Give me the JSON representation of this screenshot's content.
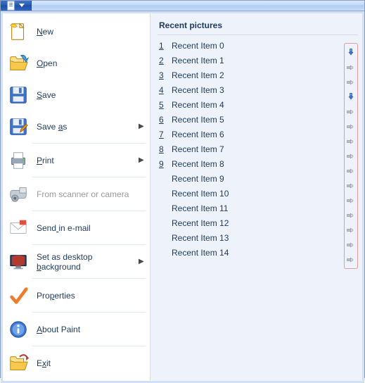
{
  "titlebar": {
    "app_button": "app-menu"
  },
  "menu": [
    {
      "id": "new",
      "label": "New",
      "accel_index": 0,
      "icon": "new-doc",
      "disabled": false,
      "submenu": false
    },
    {
      "id": "open",
      "label": "Open",
      "accel_index": 0,
      "icon": "open",
      "disabled": false,
      "submenu": false
    },
    {
      "id": "save",
      "label": "Save",
      "accel_index": 0,
      "icon": "save",
      "disabled": false,
      "submenu": false
    },
    {
      "id": "saveas",
      "label": "Save as",
      "accel_index": 5,
      "icon": "saveas",
      "disabled": false,
      "submenu": true
    },
    {
      "id": "print",
      "label": "Print",
      "accel_index": 0,
      "icon": "print",
      "disabled": false,
      "submenu": true
    },
    {
      "id": "scanner",
      "label": "From scanner or camera",
      "accel_index": -1,
      "icon": "scanner",
      "disabled": true,
      "submenu": false
    },
    {
      "id": "email",
      "label": "Send in e-mail",
      "accel_index": 4,
      "icon": "email",
      "disabled": false,
      "submenu": false
    },
    {
      "id": "desktop",
      "label": "Set as desktop background",
      "accel_index": 15,
      "icon": "desktop",
      "disabled": false,
      "submenu": true
    },
    {
      "id": "properties",
      "label": "Properties",
      "accel_index": 3,
      "icon": "check",
      "disabled": false,
      "submenu": false
    },
    {
      "id": "about",
      "label": "About Paint",
      "accel_index": 0,
      "icon": "info",
      "disabled": false,
      "submenu": false
    },
    {
      "id": "exit",
      "label": "Exit",
      "accel_index": 1,
      "icon": "exit",
      "disabled": false,
      "submenu": false
    }
  ],
  "menu_separators_after": [
    "saveas",
    "print",
    "scanner",
    "email",
    "desktop",
    "properties",
    "about"
  ],
  "recent": {
    "title": "Recent pictures",
    "items": [
      {
        "num": "1",
        "label": "Recent Item 0",
        "pinned": true
      },
      {
        "num": "2",
        "label": "Recent Item 1",
        "pinned": false
      },
      {
        "num": "3",
        "label": "Recent Item 2",
        "pinned": false
      },
      {
        "num": "4",
        "label": "Recent Item 3",
        "pinned": true
      },
      {
        "num": "5",
        "label": "Recent Item 4",
        "pinned": false
      },
      {
        "num": "6",
        "label": "Recent Item 5",
        "pinned": false
      },
      {
        "num": "7",
        "label": "Recent Item 6",
        "pinned": false
      },
      {
        "num": "8",
        "label": "Recent Item 7",
        "pinned": false
      },
      {
        "num": "9",
        "label": "Recent Item 8",
        "pinned": false
      },
      {
        "num": "",
        "label": "Recent Item 9",
        "pinned": false
      },
      {
        "num": "",
        "label": "Recent Item 10",
        "pinned": false
      },
      {
        "num": "",
        "label": "Recent Item 11",
        "pinned": false
      },
      {
        "num": "",
        "label": "Recent Item 12",
        "pinned": false
      },
      {
        "num": "",
        "label": "Recent Item 13",
        "pinned": false
      },
      {
        "num": "",
        "label": "Recent Item 14",
        "pinned": false
      }
    ]
  }
}
